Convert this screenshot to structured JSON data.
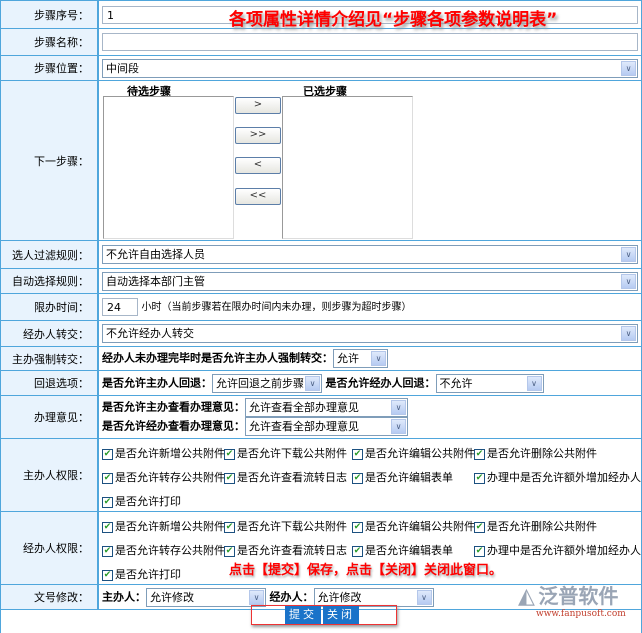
{
  "step_no": {
    "label": "步骤序号：",
    "value": "1"
  },
  "annotation_top": "各项属性详情介绍见“步骤各项参数说明表”",
  "step_name": {
    "label": "步骤名称：",
    "value": ""
  },
  "step_position": {
    "label": "步骤位置：",
    "value": "中间段"
  },
  "next_step": {
    "label": "下一步骤：",
    "available_title": "待选步骤",
    "selected_title": "已选步骤",
    "buttons": [
      ">",
      ">>",
      "<",
      "<<"
    ]
  },
  "filter_rule": {
    "label": "选人过滤规则：",
    "value": "不允许自由选择人员"
  },
  "auto_rule": {
    "label": "自动选择规则：",
    "value": "自动选择本部门主管"
  },
  "time_limit": {
    "label": "限办时间：",
    "value": "24",
    "hint": "小时（当前步骤若在限办时间内未办理，则步骤为超时步骤）"
  },
  "handler_transfer": {
    "label": "经办人转交：",
    "value": "不允许经办人转交"
  },
  "force_transfer": {
    "label": "主办强制转交：",
    "question": "经办人未办理完毕时是否允许主办人强制转交：",
    "value": "允许"
  },
  "rollback": {
    "label": "回退选项：",
    "q1": "是否允许主办人回退：",
    "v1": "允许回退之前步骤",
    "q2": "是否允许经办人回退：",
    "v2": "不允许"
  },
  "opinion": {
    "label": "办理意见：",
    "q1": "是否允许主办查看办理意见：",
    "v1": "允许查看全部办理意见",
    "q2": "是否允许经办查看办理意见：",
    "v2": "允许查看全部办理意见"
  },
  "host_perm": {
    "label": "主办人权限：",
    "items": [
      "是否允许新增公共附件",
      "是否允许下载公共附件",
      "是否允许编辑公共附件",
      "是否允许删除公共附件",
      "是否允许转存公共附件",
      "是否允许查看流转日志",
      "是否允许编辑表单",
      "办理中是否允许额外增加经办人",
      "是否允许打印"
    ]
  },
  "handler_perm": {
    "label": "经办人权限：",
    "items": [
      "是否允许新增公共附件",
      "是否允许下载公共附件",
      "是否允许编辑公共附件",
      "是否允许删除公共附件",
      "是否允许转存公共附件",
      "是否允许查看流转日志",
      "是否允许编辑表单",
      "办理中是否允许额外增加经办人",
      "是否允许打印"
    ]
  },
  "annotation_bottom": "点击【提交】保存，点击【关闭】关闭此窗口。",
  "doc_no": {
    "label": "文号修改：",
    "host_label": "主办人：",
    "host_value": "允许修改",
    "handler_label": "经办人：",
    "handler_value": "允许修改"
  },
  "actions": {
    "submit": "提交",
    "close": "关闭"
  },
  "logo": {
    "name": "泛普软件",
    "url": "www.fanpusoft.com"
  }
}
